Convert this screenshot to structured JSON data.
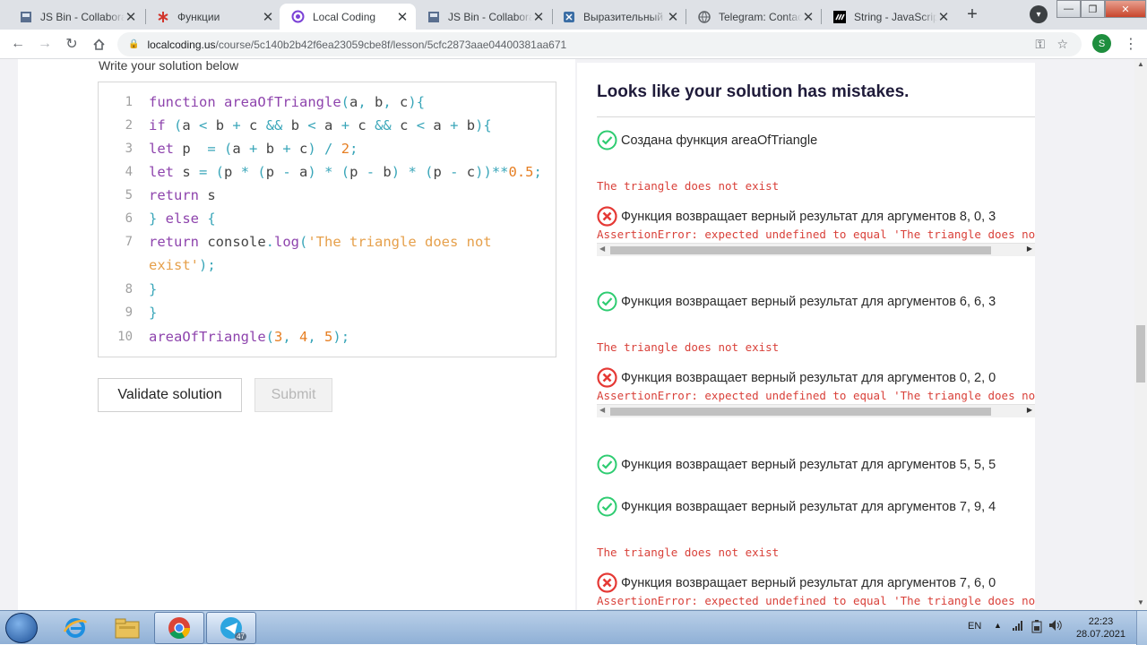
{
  "browser": {
    "tabs": [
      {
        "title": "JS Bin - Collaborati",
        "icon": "jsbin-icon"
      },
      {
        "title": "Функции",
        "icon": "htmlacademy-icon"
      },
      {
        "title": "Local Coding",
        "icon": "localcoding-icon",
        "active": true
      },
      {
        "title": "JS Bin - Collaborati",
        "icon": "jsbin-icon"
      },
      {
        "title": "Выразительный JS",
        "icon": "bookmark-icon"
      },
      {
        "title": "Telegram: Contact",
        "icon": "globe-icon"
      },
      {
        "title": "String - JavaScript",
        "icon": "mdn-icon"
      }
    ],
    "profile_initial": "S",
    "url_host": "localcoding.us",
    "url_path": "/course/5c140b2b42f6ea23059cbe8f/lesson/5cfc2873aae04400381aa671"
  },
  "editor": {
    "heading": "Write your solution below",
    "line_numbers": [
      "1",
      "2",
      "3",
      "4",
      "5",
      "6",
      "7",
      "8",
      "9",
      "10"
    ],
    "lines": [
      [
        [
          "fn",
          "function "
        ],
        [
          "fn",
          "areaOfTriangle"
        ],
        [
          "pu",
          "("
        ],
        [
          "id",
          "a"
        ],
        [
          "pu",
          ", "
        ],
        [
          "id",
          "b"
        ],
        [
          "pu",
          ", "
        ],
        [
          "id",
          "c"
        ],
        [
          "pu",
          "){"
        ]
      ],
      [
        [
          "kw",
          "if "
        ],
        [
          "pu",
          "("
        ],
        [
          "id",
          "a "
        ],
        [
          "op",
          "< "
        ],
        [
          "id",
          "b "
        ],
        [
          "op",
          "+ "
        ],
        [
          "id",
          "c "
        ],
        [
          "op",
          "&& "
        ],
        [
          "id",
          "b "
        ],
        [
          "op",
          "< "
        ],
        [
          "id",
          "a "
        ],
        [
          "op",
          "+ "
        ],
        [
          "id",
          "c "
        ],
        [
          "op",
          "&& "
        ],
        [
          "id",
          "c "
        ],
        [
          "op",
          "< "
        ],
        [
          "id",
          "a "
        ],
        [
          "op",
          "+ "
        ],
        [
          "id",
          "b"
        ],
        [
          "pu",
          "){"
        ]
      ],
      [
        [
          "kw",
          "let "
        ],
        [
          "id",
          "p  "
        ],
        [
          "op",
          "= "
        ],
        [
          "pu",
          "("
        ],
        [
          "id",
          "a "
        ],
        [
          "op",
          "+ "
        ],
        [
          "id",
          "b "
        ],
        [
          "op",
          "+ "
        ],
        [
          "id",
          "c"
        ],
        [
          "pu",
          ") "
        ],
        [
          "op",
          "/ "
        ],
        [
          "num",
          "2"
        ],
        [
          "pu",
          ";"
        ]
      ],
      [
        [
          "kw",
          "let "
        ],
        [
          "id",
          "s "
        ],
        [
          "op",
          "= "
        ],
        [
          "pu",
          "("
        ],
        [
          "id",
          "p "
        ],
        [
          "op",
          "* "
        ],
        [
          "pu",
          "("
        ],
        [
          "id",
          "p "
        ],
        [
          "op",
          "- "
        ],
        [
          "id",
          "a"
        ],
        [
          "pu",
          ") "
        ],
        [
          "op",
          "* "
        ],
        [
          "pu",
          "("
        ],
        [
          "id",
          "p "
        ],
        [
          "op",
          "- "
        ],
        [
          "id",
          "b"
        ],
        [
          "pu",
          ") "
        ],
        [
          "op",
          "* "
        ],
        [
          "pu",
          "("
        ],
        [
          "id",
          "p "
        ],
        [
          "op",
          "- "
        ],
        [
          "id",
          "c"
        ],
        [
          "pu",
          "))"
        ],
        [
          "op",
          "**"
        ],
        [
          "num",
          "0.5"
        ],
        [
          "pu",
          ";"
        ]
      ],
      [
        [
          "kw",
          "return "
        ],
        [
          "id",
          "s"
        ]
      ],
      [
        [
          "pu",
          "} "
        ],
        [
          "kw",
          "else "
        ],
        [
          "pu",
          "{"
        ]
      ],
      [
        [
          "kw",
          "return "
        ],
        [
          "id",
          "console"
        ],
        [
          "pu",
          "."
        ],
        [
          "fn",
          "log"
        ],
        [
          "pu",
          "("
        ],
        [
          "str",
          "'The triangle does not"
        ]
      ],
      [
        [
          "str",
          "exist'"
        ],
        [
          "pu",
          ");"
        ]
      ],
      [
        [
          "pu",
          "}"
        ]
      ],
      [
        [
          "pu",
          "}"
        ]
      ],
      [
        [
          "fn",
          "areaOfTriangle"
        ],
        [
          "pu",
          "("
        ],
        [
          "num",
          "3"
        ],
        [
          "pu",
          ", "
        ],
        [
          "num",
          "4"
        ],
        [
          "pu",
          ", "
        ],
        [
          "num",
          "5"
        ],
        [
          "pu",
          ");"
        ]
      ]
    ]
  },
  "buttons": {
    "validate": "Validate solution",
    "submit": "Submit"
  },
  "results": {
    "title": "Looks like your solution has mistakes.",
    "items": [
      {
        "kind": "pass",
        "text": "Создана функция areaOfTriangle"
      },
      {
        "kind": "output",
        "text": "The triangle does not exist"
      },
      {
        "kind": "fail",
        "text": "Функция возвращает верный результат для аргументов 8, 0, 3"
      },
      {
        "kind": "error",
        "text": "AssertionError: expected undefined to equal 'The triangle does not exist'"
      },
      {
        "kind": "pass",
        "text": "Функция возвращает верный результат для аргументов 6, 6, 3"
      },
      {
        "kind": "output",
        "text": "The triangle does not exist"
      },
      {
        "kind": "fail",
        "text": "Функция возвращает верный результат для аргументов 0, 2, 0"
      },
      {
        "kind": "error",
        "text": "AssertionError: expected undefined to equal 'The triangle does not exist'"
      },
      {
        "kind": "pass",
        "text": "Функция возвращает верный результат для аргументов 5, 5, 5"
      },
      {
        "kind": "pass",
        "text": "Функция возвращает верный результат для аргументов 7, 9, 4"
      },
      {
        "kind": "output",
        "text": "The triangle does not exist"
      },
      {
        "kind": "fail",
        "text": "Функция возвращает верный результат для аргументов 7, 6, 0"
      },
      {
        "kind": "error",
        "text": "AssertionError: expected undefined to equal 'The triangle does not exist'"
      }
    ]
  },
  "taskbar": {
    "telegram_badge": "47",
    "language": "EN",
    "time": "22:23",
    "date": "28.07.2021"
  },
  "colors": {
    "pass": "#2ecc71",
    "fail": "#e53935",
    "error_text": "#d9413a",
    "keyword": "#8e44ad",
    "operator": "#3aa6b9",
    "number": "#e67e22",
    "string": "#e6a04b"
  }
}
